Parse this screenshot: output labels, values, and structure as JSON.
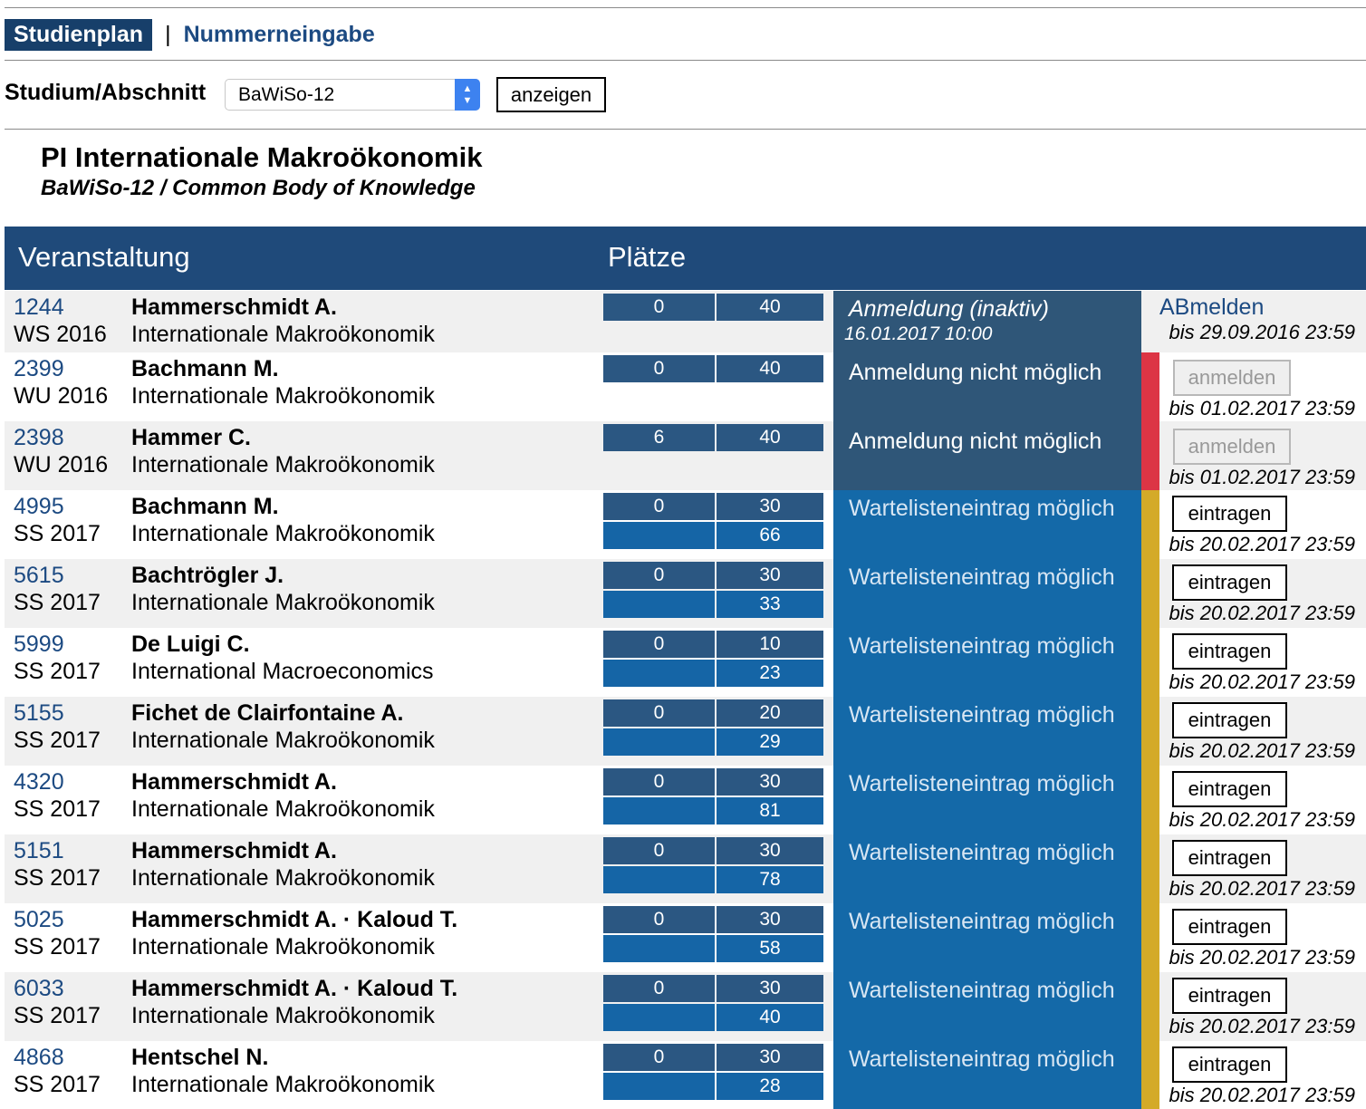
{
  "nav": {
    "tab_active": "Studienplan",
    "separator": "|",
    "tab_other": "Nummerneingabe"
  },
  "filter": {
    "label": "Studium/Abschnitt",
    "selected": "BaWiSo-12",
    "button": "anzeigen"
  },
  "heading": {
    "title": "PI Internationale Makroökonomik",
    "subtitle": "BaWiSo-12 / Common Body of Knowledge"
  },
  "table": {
    "col_course": "Veranstaltung",
    "col_places": "Plätze",
    "rows": [
      {
        "num": "1244",
        "semester": "WS 2016",
        "lecturer": "Hammerschmidt A.",
        "course": "Internationale Makroökonomik",
        "taken": "0",
        "capacity": "40",
        "waitlist": "",
        "status": "Anmeldung (inaktiv)",
        "status_date": "16.01.2017 10:00",
        "action_type": "link",
        "action_label": "ABmelden",
        "deadline": "bis 29.09.2016 23:59"
      },
      {
        "num": "2399",
        "semester": "WU 2016",
        "lecturer": "Bachmann M.",
        "course": "Internationale Makroökonomik",
        "taken": "0",
        "capacity": "40",
        "waitlist": "",
        "status": "Anmeldung nicht möglich",
        "status_date": "",
        "action_type": "disabled",
        "action_label": "anmelden",
        "deadline": "bis 01.02.2017 23:59"
      },
      {
        "num": "2398",
        "semester": "WU 2016",
        "lecturer": "Hammer C.",
        "course": "Internationale Makroökonomik",
        "taken": "6",
        "capacity": "40",
        "waitlist": "",
        "status": "Anmeldung nicht möglich",
        "status_date": "",
        "action_type": "disabled",
        "action_label": "anmelden",
        "deadline": "bis 01.02.2017 23:59"
      },
      {
        "num": "4995",
        "semester": "SS 2017",
        "lecturer": "Bachmann M.",
        "course": "Internationale Makroökonomik",
        "taken": "0",
        "capacity": "30",
        "waitlist": "66",
        "status": "Wartelisteneintrag möglich",
        "status_date": "",
        "action_type": "button",
        "action_label": "eintragen",
        "deadline": "bis 20.02.2017 23:59"
      },
      {
        "num": "5615",
        "semester": "SS 2017",
        "lecturer": "Bachtrögler J.",
        "course": "Internationale Makroökonomik",
        "taken": "0",
        "capacity": "30",
        "waitlist": "33",
        "status": "Wartelisteneintrag möglich",
        "status_date": "",
        "action_type": "button",
        "action_label": "eintragen",
        "deadline": "bis 20.02.2017 23:59"
      },
      {
        "num": "5999",
        "semester": "SS 2017",
        "lecturer": "De Luigi C.",
        "course": "International Macroeconomics",
        "taken": "0",
        "capacity": "10",
        "waitlist": "23",
        "status": "Wartelisteneintrag möglich",
        "status_date": "",
        "action_type": "button",
        "action_label": "eintragen",
        "deadline": "bis 20.02.2017 23:59"
      },
      {
        "num": "5155",
        "semester": "SS 2017",
        "lecturer": "Fichet de Clairfontaine A.",
        "course": "Internationale Makroökonomik",
        "taken": "0",
        "capacity": "20",
        "waitlist": "29",
        "status": "Wartelisteneintrag möglich",
        "status_date": "",
        "action_type": "button",
        "action_label": "eintragen",
        "deadline": "bis 20.02.2017 23:59"
      },
      {
        "num": "4320",
        "semester": "SS 2017",
        "lecturer": "Hammerschmidt A.",
        "course": "Internationale Makroökonomik",
        "taken": "0",
        "capacity": "30",
        "waitlist": "81",
        "status": "Wartelisteneintrag möglich",
        "status_date": "",
        "action_type": "button",
        "action_label": "eintragen",
        "deadline": "bis 20.02.2017 23:59"
      },
      {
        "num": "5151",
        "semester": "SS 2017",
        "lecturer": "Hammerschmidt A.",
        "course": "Internationale Makroökonomik",
        "taken": "0",
        "capacity": "30",
        "waitlist": "78",
        "status": "Wartelisteneintrag möglich",
        "status_date": "",
        "action_type": "button",
        "action_label": "eintragen",
        "deadline": "bis 20.02.2017 23:59"
      },
      {
        "num": "5025",
        "semester": "SS 2017",
        "lecturer": "Hammerschmidt A. · Kaloud T.",
        "course": "Internationale Makroökonomik",
        "taken": "0",
        "capacity": "30",
        "waitlist": "58",
        "status": "Wartelisteneintrag möglich",
        "status_date": "",
        "action_type": "button",
        "action_label": "eintragen",
        "deadline": "bis 20.02.2017 23:59"
      },
      {
        "num": "6033",
        "semester": "SS 2017",
        "lecturer": "Hammerschmidt A. · Kaloud T.",
        "course": "Internationale Makroökonomik",
        "taken": "0",
        "capacity": "30",
        "waitlist": "40",
        "status": "Wartelisteneintrag möglich",
        "status_date": "",
        "action_type": "button",
        "action_label": "eintragen",
        "deadline": "bis 20.02.2017 23:59"
      },
      {
        "num": "4868",
        "semester": "SS 2017",
        "lecturer": "Hentschel N.",
        "course": "Internationale Makroökonomik",
        "taken": "0",
        "capacity": "30",
        "waitlist": "28",
        "status": "Wartelisteneintrag möglich",
        "status_date": "",
        "action_type": "button",
        "action_label": "eintragen",
        "deadline": "bis 20.02.2017 23:59"
      }
    ]
  },
  "colors": {
    "header_bg": "#1f4a7a",
    "places_box": "#2b5782",
    "waitlist_box": "#1565a6",
    "status_inactive": "#2f5678",
    "status_waitlist": "#1469a8",
    "bar_red": "#dc3545",
    "bar_yellow": "#d4aa28"
  }
}
